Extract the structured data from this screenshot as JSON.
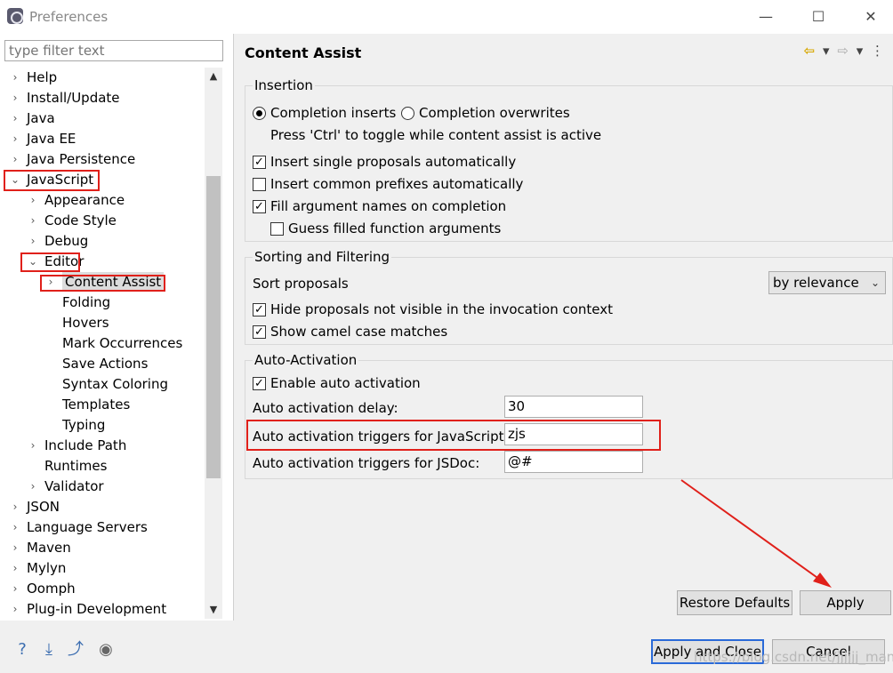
{
  "window": {
    "title": "Preferences",
    "minimize": "—",
    "maximize": "☐",
    "close": "✕"
  },
  "filter": {
    "placeholder": "type filter text"
  },
  "tree": [
    {
      "label": "Help",
      "chevron": "›"
    },
    {
      "label": "Install/Update",
      "chevron": "›"
    },
    {
      "label": "Java",
      "chevron": "›"
    },
    {
      "label": "Java EE",
      "chevron": "›"
    },
    {
      "label": "Java Persistence",
      "chevron": "›"
    },
    {
      "label": "JavaScript",
      "chevron": "⌄"
    },
    {
      "label": "Appearance",
      "chevron": "›"
    },
    {
      "label": "Code Style",
      "chevron": "›"
    },
    {
      "label": "Debug",
      "chevron": "›"
    },
    {
      "label": "Editor",
      "chevron": "⌄"
    },
    {
      "label": "Content Assist",
      "chevron": "›"
    },
    {
      "label": "Folding",
      "chevron": ""
    },
    {
      "label": "Hovers",
      "chevron": ""
    },
    {
      "label": "Mark Occurrences",
      "chevron": ""
    },
    {
      "label": "Save Actions",
      "chevron": ""
    },
    {
      "label": "Syntax Coloring",
      "chevron": ""
    },
    {
      "label": "Templates",
      "chevron": ""
    },
    {
      "label": "Typing",
      "chevron": ""
    },
    {
      "label": "Include Path",
      "chevron": "›"
    },
    {
      "label": "Runtimes",
      "chevron": ""
    },
    {
      "label": "Validator",
      "chevron": "›"
    },
    {
      "label": "JSON",
      "chevron": "›"
    },
    {
      "label": "Language Servers",
      "chevron": "›"
    },
    {
      "label": "Maven",
      "chevron": "›"
    },
    {
      "label": "Mylyn",
      "chevron": "›"
    },
    {
      "label": "Oomph",
      "chevron": "›"
    },
    {
      "label": "Plug-in Development",
      "chevron": "›"
    }
  ],
  "page": {
    "title": "Content Assist"
  },
  "insertion": {
    "title": "Insertion",
    "completion_inserts": "Completion inserts",
    "completion_overwrites": "Completion overwrites",
    "toggle_hint": "Press 'Ctrl' to toggle while content assist is active",
    "insert_single": "Insert single proposals automatically",
    "insert_common": "Insert common prefixes automatically",
    "fill_args": "Fill argument names on completion",
    "guess_args": "Guess filled function arguments"
  },
  "sorting": {
    "title": "Sorting and Filtering",
    "sort_label": "Sort proposals",
    "sort_value": "by relevance",
    "hide_not_visible": "Hide proposals not visible in the invocation context",
    "camel_case": "Show camel case matches"
  },
  "auto": {
    "title": "Auto-Activation",
    "enable": "Enable auto activation",
    "delay_label": "Auto activation delay:",
    "delay_value": "30",
    "js_label": "Auto activation triggers for JavaScript:",
    "js_value": "zjs",
    "jsdoc_label": "Auto activation triggers for JSDoc:",
    "jsdoc_value": "@#"
  },
  "buttons": {
    "restore": "Restore Defaults",
    "apply": "Apply",
    "apply_close": "Apply and Close",
    "cancel": "Cancel"
  },
  "bottom_icons": [
    "help-icon",
    "import-icon",
    "export-icon",
    "record-icon"
  ],
  "watermark": "https://blog.csdn.net/jjjjjj_man",
  "colors": {
    "highlight": "#e0201a",
    "primary_border": "#2a6ad8"
  }
}
